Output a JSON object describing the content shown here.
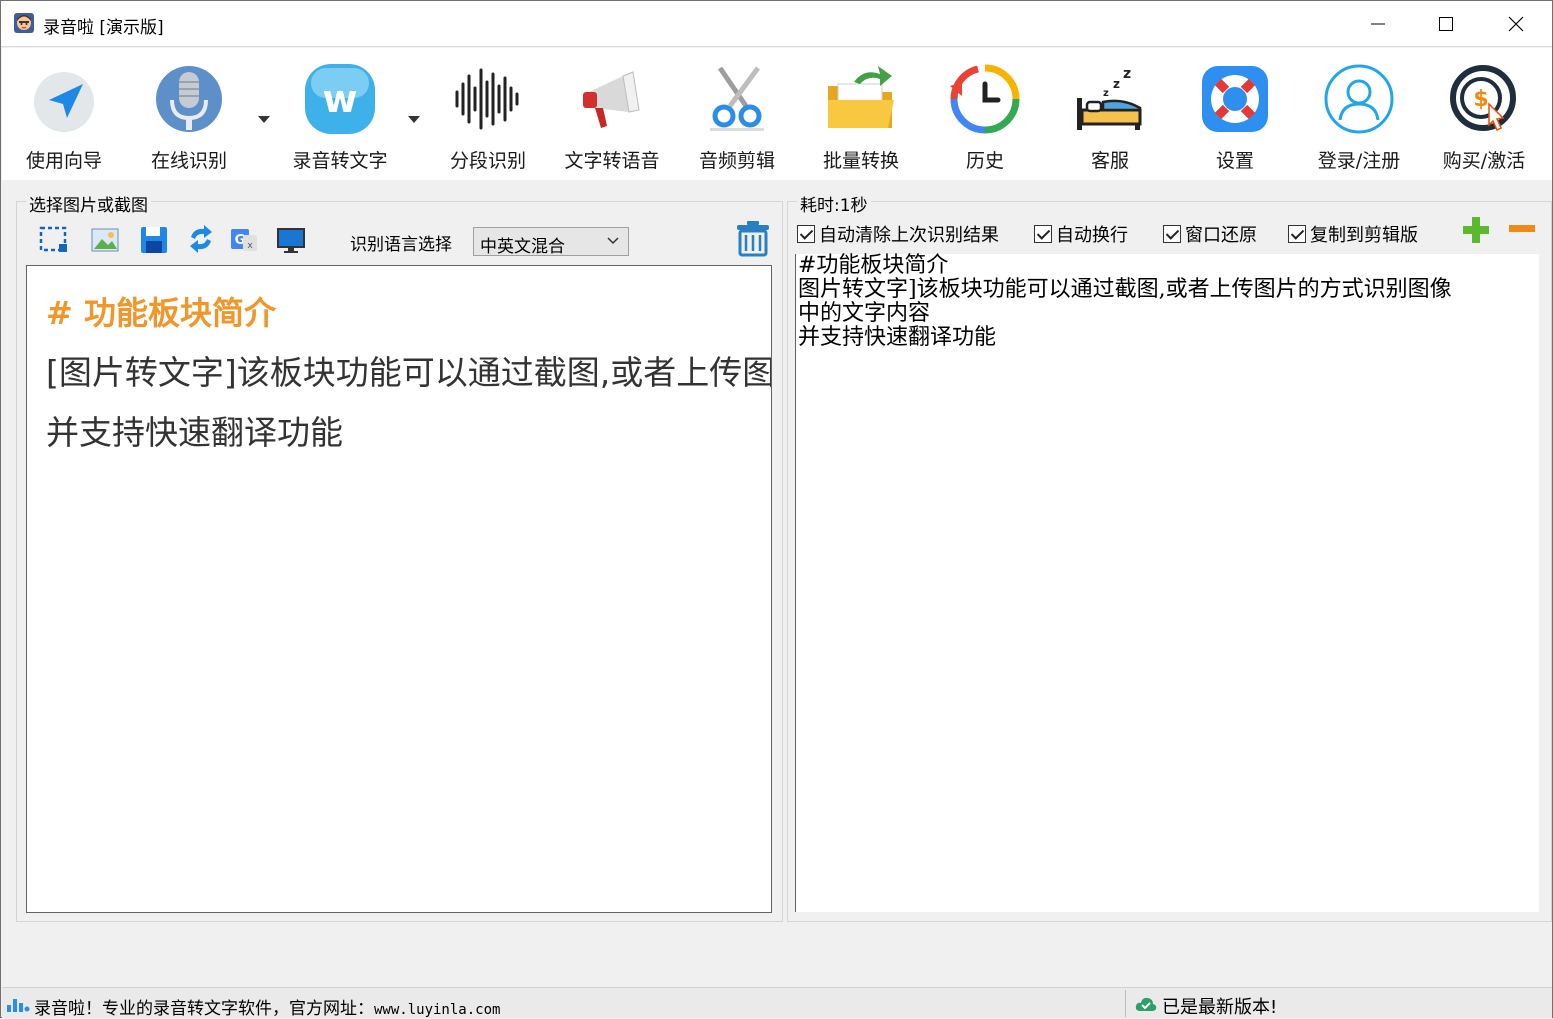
{
  "window": {
    "title": "录音啦 [演示版]"
  },
  "toolbar": {
    "items": [
      {
        "label": "使用向导",
        "icon": "navigation-arrow-icon",
        "has_dropdown": false
      },
      {
        "label": "在线识别",
        "icon": "microphone-icon",
        "has_dropdown": true
      },
      {
        "label": "录音转文字",
        "icon": "w-logo-icon",
        "has_dropdown": true
      },
      {
        "label": "分段识别",
        "icon": "waveform-icon",
        "has_dropdown": false
      },
      {
        "label": "文字转语音",
        "icon": "megaphone-icon",
        "has_dropdown": false
      },
      {
        "label": "音频剪辑",
        "icon": "scissors-icon",
        "has_dropdown": false
      },
      {
        "label": "批量转换",
        "icon": "folder-convert-icon",
        "has_dropdown": false
      },
      {
        "label": "历史",
        "icon": "history-clock-icon",
        "has_dropdown": false
      },
      {
        "label": "客服",
        "icon": "bed-sleep-icon",
        "has_dropdown": false
      },
      {
        "label": "设置",
        "icon": "lifebuoy-icon",
        "has_dropdown": false
      },
      {
        "label": "登录/注册",
        "icon": "user-icon",
        "has_dropdown": false
      },
      {
        "label": "购买/激活",
        "icon": "dollar-coin-icon",
        "has_dropdown": false
      }
    ]
  },
  "left_panel": {
    "title": "选择图片或截图",
    "tools": [
      "screenshot-select-icon",
      "open-image-icon",
      "save-icon",
      "refresh-icon",
      "translate-icon",
      "screen-icon"
    ],
    "language_label": "识别语言选择",
    "language_value": "中英文混合",
    "preview": {
      "heading": "# 功能板块简介",
      "line1": "[图片转文字]该板块功能可以通过截图,或者上传图",
      "line2": "并支持快速翻译功能"
    }
  },
  "right_panel": {
    "title": "耗时:1秒",
    "checkboxes": [
      {
        "label": "自动清除上次识别结果",
        "checked": true
      },
      {
        "label": "自动换行",
        "checked": true
      },
      {
        "label": "窗口还原",
        "checked": true
      },
      {
        "label": "复制到剪辑版",
        "checked": true
      }
    ],
    "result_lines": [
      "#功能板块简介",
      "图片转文字]该板块功能可以通过截图,或者上传图片的方式识别图像",
      "中的文字内容",
      "并支持快速翻译功能"
    ]
  },
  "statusbar": {
    "left_text": "录音啦！专业的录音转文字软件，官方网址：",
    "url": "www.luyinla.com",
    "right_text": "已是最新版本!"
  },
  "colors": {
    "accent_orange": "#f0962a",
    "icon_blue": "#2a8ee6",
    "add_green": "#5cb82d",
    "remove_orange": "#f08a16"
  }
}
